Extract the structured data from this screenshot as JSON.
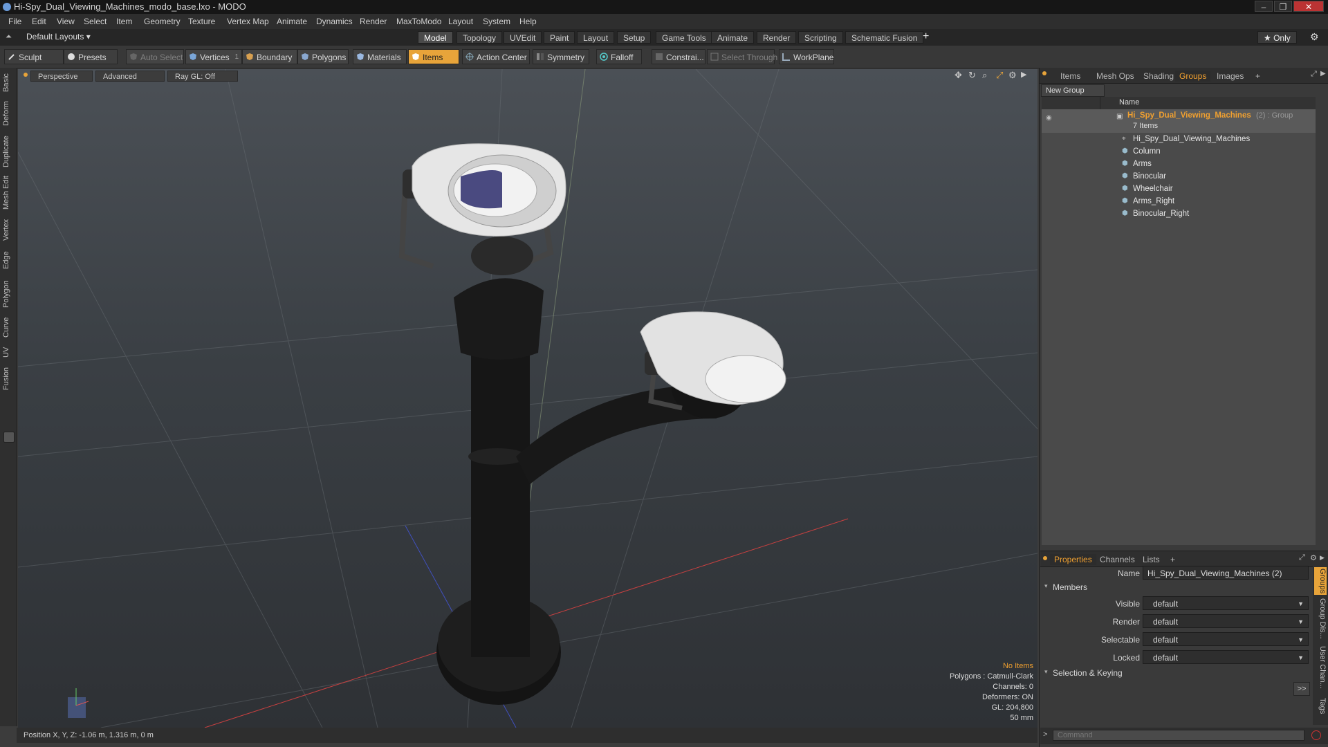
{
  "window": {
    "title": "Hi-Spy_Dual_Viewing_Machines_modo_base.lxo - MODO",
    "minimize": "–",
    "restore": "❐",
    "close": "✕"
  },
  "menu": [
    "File",
    "Edit",
    "View",
    "Select",
    "Item",
    "Geometry",
    "Texture",
    "Vertex Map",
    "Animate",
    "Dynamics",
    "Render",
    "MaxToModo",
    "Layout",
    "System",
    "Help"
  ],
  "layout_selector": "Default Layouts ▾",
  "layout_tabs": [
    {
      "label": "Model",
      "active": true
    },
    {
      "label": "Topology",
      "active": false
    },
    {
      "label": "UVEdit",
      "active": false
    },
    {
      "label": "Paint",
      "active": false
    },
    {
      "label": "Layout",
      "active": false
    },
    {
      "label": "Setup",
      "active": false
    },
    {
      "label": "Game Tools",
      "active": false
    },
    {
      "label": "Animate",
      "active": false
    },
    {
      "label": "Render",
      "active": false
    },
    {
      "label": "Scripting",
      "active": false
    },
    {
      "label": "Schematic Fusion",
      "active": false
    }
  ],
  "add_tab": "+",
  "only_button": "★ Only",
  "toolbar": {
    "sculpt": "Sculpt",
    "presets": "Presets",
    "auto_select": "Auto Select",
    "vertices": "Vertices",
    "vertices_count": "1",
    "boundary": "Boundary",
    "polygons": "Polygons",
    "materials": "Materials",
    "items": "Items",
    "action_center": "Action Center",
    "symmetry": "Symmetry",
    "falloff": "Falloff",
    "constraints": "Constrai...",
    "select_through": "Select Through",
    "workplane": "WorkPlane"
  },
  "left_tabs": [
    "Basic",
    "Deform",
    "Duplicate",
    "Mesh Edit",
    "Vertex",
    "Edge",
    "Polygon",
    "Curve",
    "UV",
    "Fusion"
  ],
  "viewport": {
    "view": "Perspective",
    "advanced": "Advanced",
    "raygl": "Ray GL: Off",
    "info": {
      "no_items": "No Items",
      "polygons": "Polygons : Catmull-Clark",
      "channels": "Channels: 0",
      "deformers": "Deformers: ON",
      "gl": "GL: 204,800",
      "focal": "50 mm"
    }
  },
  "status": "Position X, Y, Z:  -1.06 m, 1.316 m, 0 m",
  "right_tabs": [
    {
      "label": "Items",
      "active": false
    },
    {
      "label": "Mesh Ops",
      "active": false
    },
    {
      "label": "Shading",
      "active": false
    },
    {
      "label": "Groups",
      "active": true
    },
    {
      "label": "Images",
      "active": false
    }
  ],
  "new_group": "New Group",
  "list_header": "Name",
  "group": {
    "name": "Hi_Spy_Dual_Viewing_Machines",
    "suffix": "(2) : Group",
    "count": "7 Items",
    "children": [
      "Hi_Spy_Dual_Viewing_Machines",
      "Column",
      "Arms",
      "Binocular",
      "Wheelchair",
      "Arms_Right",
      "Binocular_Right"
    ]
  },
  "props_tabs": [
    {
      "label": "Properties",
      "active": true
    },
    {
      "label": "Channels",
      "active": false
    },
    {
      "label": "Lists",
      "active": false
    }
  ],
  "props": {
    "name_label": "Name",
    "name_value": "Hi_Spy_Dual_Viewing_Machines (2)",
    "members": "Members",
    "visible_label": "Visible",
    "visible_value": "default",
    "render_label": "Render",
    "render_value": "default",
    "selectable_label": "Selectable",
    "selectable_value": "default",
    "locked_label": "Locked",
    "locked_value": "default",
    "selection_keying": "Selection & Keying",
    "expand": ">>"
  },
  "side_vtabs": [
    "Groups",
    "Group Dis...",
    "User Chan...",
    "Tags"
  ],
  "command_placeholder": "Command",
  "colors": {
    "accent": "#f0a030",
    "active_tool": "#e8a43a"
  }
}
